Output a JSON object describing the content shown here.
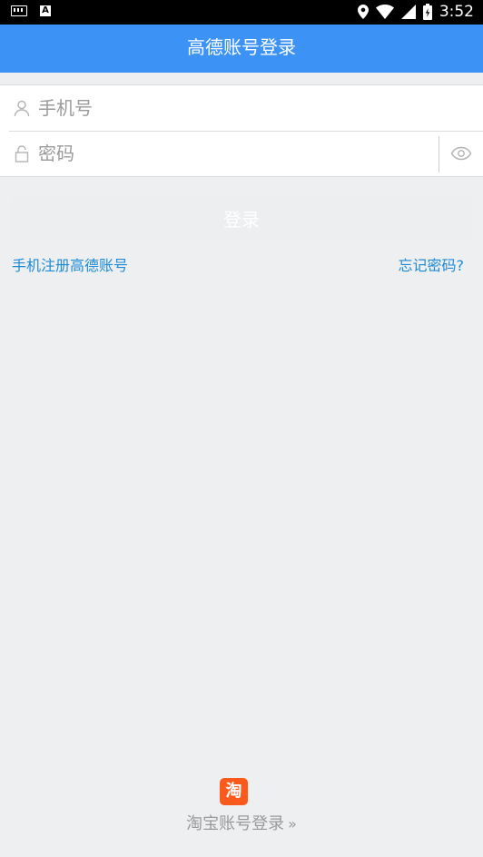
{
  "status_bar": {
    "time": "3:52",
    "icons": [
      "keyboard-icon",
      "font-a-icon",
      "location-icon",
      "wifi-icon",
      "signal-icon",
      "battery-charging-icon"
    ]
  },
  "app_bar": {
    "title": "高德账号登录"
  },
  "form": {
    "phone_placeholder": "手机号",
    "password_placeholder": "密码"
  },
  "login_button": {
    "label": "登录"
  },
  "links": {
    "register": "手机注册高德账号",
    "forgot": "忘记密码?"
  },
  "taobao": {
    "icon_text": "淘",
    "label": "淘宝账号登录",
    "chevron": "»"
  },
  "colors": {
    "primary": "#3c93f5",
    "link": "#1e8ad6",
    "taobao": "#fb5a1c",
    "background": "#eeeff1"
  }
}
